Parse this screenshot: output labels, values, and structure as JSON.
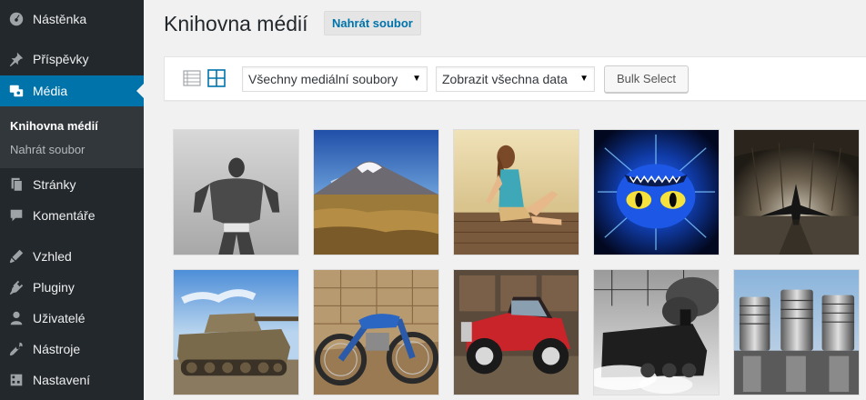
{
  "sidebar": {
    "items": [
      {
        "label": "Nástěnka",
        "icon": "dashboard-icon"
      },
      {
        "label": "Příspěvky",
        "icon": "pushpin-icon"
      },
      {
        "label": "Média",
        "icon": "media-icon"
      },
      {
        "label": "Stránky",
        "icon": "pages-icon"
      },
      {
        "label": "Komentáře",
        "icon": "comments-icon"
      },
      {
        "label": "Vzhled",
        "icon": "appearance-icon"
      },
      {
        "label": "Pluginy",
        "icon": "plugins-icon"
      },
      {
        "label": "Uživatelé",
        "icon": "users-icon"
      },
      {
        "label": "Nástroje",
        "icon": "tools-icon"
      },
      {
        "label": "Nastavení",
        "icon": "settings-icon"
      }
    ],
    "submenu": [
      {
        "label": "Knihovna médií"
      },
      {
        "label": "Nahrát soubor"
      }
    ]
  },
  "header": {
    "title": "Knihovna médií",
    "add_new": "Nahrát soubor"
  },
  "toolbar": {
    "type_filter": "Všechny mediální soubory",
    "date_filter": "Zobrazit všechna data",
    "bulk_select": "Bulk Select"
  },
  "colors": {
    "sidebar_bg": "#23282d",
    "active_bg": "#0073aa",
    "accent": "#0073aa"
  }
}
